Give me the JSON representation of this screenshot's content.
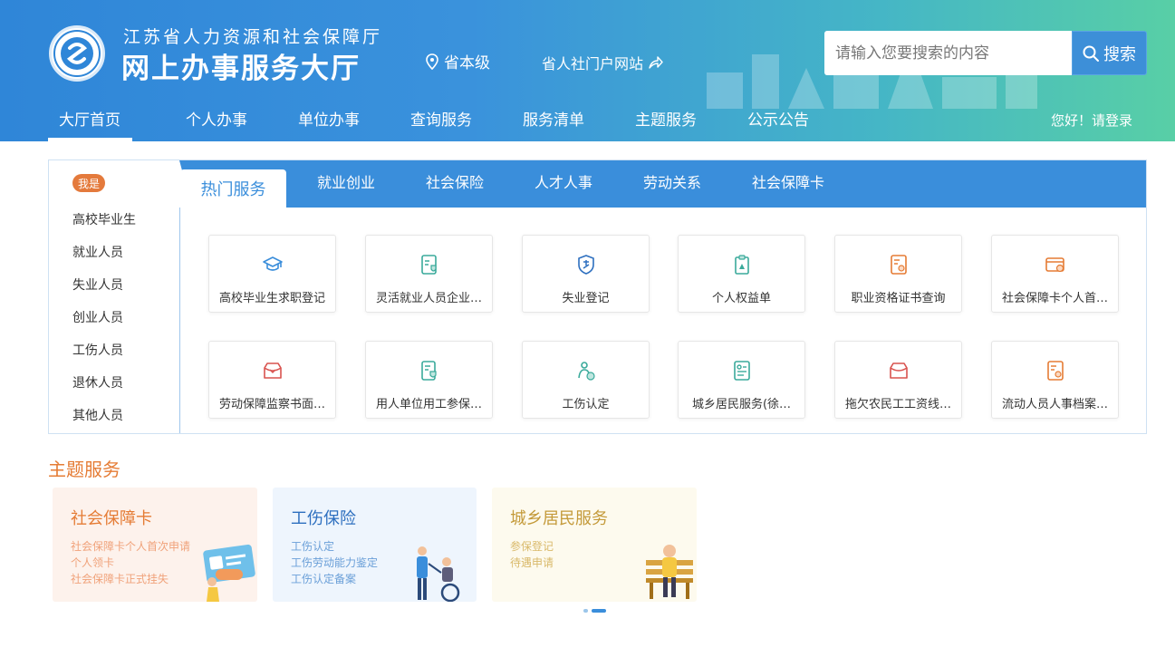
{
  "header": {
    "org_name": "江苏省人力资源和社会保障厅",
    "site_name": "网上办事服务大厅",
    "location": "省本级",
    "portal_link": "省人社门户网站",
    "search_placeholder": "请输入您要搜索的内容",
    "search_button": "搜索",
    "login_text": "您好！请登录"
  },
  "nav": {
    "items": [
      "大厅首页",
      "个人办事",
      "单位办事",
      "查询服务",
      "服务清单",
      "主题服务",
      "公示公告"
    ],
    "active_index": 0
  },
  "sidebar": {
    "badge": "我是",
    "items": [
      "高校毕业生",
      "就业人员",
      "失业人员",
      "创业人员",
      "工伤人员",
      "退休人员",
      "其他人员"
    ]
  },
  "tabs": {
    "active": "热门服务",
    "items": [
      "就业创业",
      "社会保险",
      "人才人事",
      "劳动关系",
      "社会保障卡"
    ]
  },
  "services": [
    {
      "label": "高校毕业生求职登记",
      "icon": "graduation-cap-icon"
    },
    {
      "label": "灵活就业人员企业…",
      "icon": "id-card-shield-icon"
    },
    {
      "label": "失业登记",
      "icon": "unemployment-shield-icon"
    },
    {
      "label": "个人权益单",
      "icon": "clipboard-icon"
    },
    {
      "label": "职业资格证书查询",
      "icon": "certificate-icon"
    },
    {
      "label": "社会保障卡个人首…",
      "icon": "card-gear-icon"
    },
    {
      "label": "劳动保障监察书面…",
      "icon": "inspection-box-icon"
    },
    {
      "label": "用人单位用工参保…",
      "icon": "document-shield-icon"
    },
    {
      "label": "工伤认定",
      "icon": "injury-person-icon"
    },
    {
      "label": "城乡居民服务(徐…",
      "icon": "resident-card-icon"
    },
    {
      "label": "拖欠农民工工资线…",
      "icon": "wage-box-icon"
    },
    {
      "label": "流动人员人事档案…",
      "icon": "archive-card-icon"
    }
  ],
  "theme": {
    "title": "主题服务",
    "cards": [
      {
        "title": "社会保障卡",
        "links": [
          "社会保障卡个人首次申请",
          "个人领卡",
          "社会保障卡正式挂失"
        ]
      },
      {
        "title": "工伤保险",
        "links": [
          "工伤认定",
          "工伤劳动能力鉴定",
          "工伤认定备案"
        ]
      },
      {
        "title": "城乡居民服务",
        "links": [
          "参保登记",
          "待遇申请"
        ]
      }
    ]
  },
  "colors": {
    "header_blue": "#2f86d8",
    "header_green": "#58cfa6",
    "accent_blue": "#3a8edb",
    "accent_orange": "#e57c35"
  }
}
